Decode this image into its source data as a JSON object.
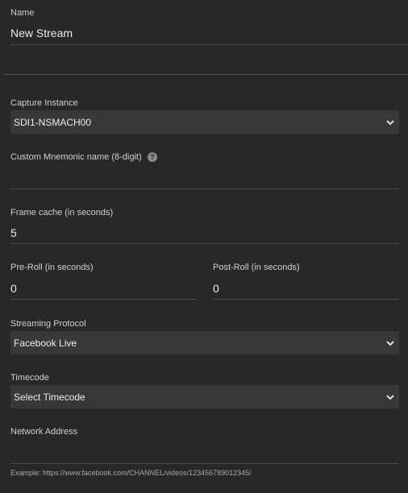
{
  "name": {
    "label": "Name",
    "value": "New Stream"
  },
  "capture_instance": {
    "label": "Capture Instance",
    "selected": "SDI1-NSMACH00"
  },
  "mnemonic": {
    "label": "Custom Mnemonic name (8-digit)",
    "help_icon": "?",
    "value": ""
  },
  "frame_cache": {
    "label": "Frame cache (in seconds)",
    "value": "5"
  },
  "pre_roll": {
    "label": "Pre-Roll (in seconds)",
    "value": "0"
  },
  "post_roll": {
    "label": "Post-Roll (in seconds)",
    "value": "0"
  },
  "streaming_protocol": {
    "label": "Streaming Protocol",
    "selected": "Facebook Live"
  },
  "timecode": {
    "label": "Timecode",
    "selected": "Select Timecode"
  },
  "network_address": {
    "label": "Network Address",
    "value": "",
    "hint": "Example: https://www.facebook.com/CHANNEL/videos/123456789012345/"
  },
  "colors": {
    "background": "#282828",
    "select_background": "#383838",
    "text": "#ececec",
    "label": "#cfcfcf"
  }
}
